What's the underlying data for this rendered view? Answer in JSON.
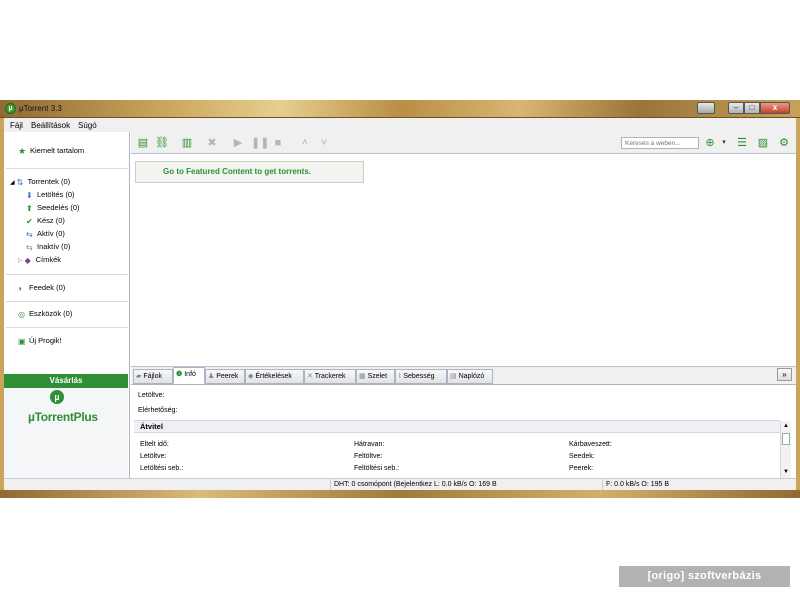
{
  "window": {
    "title": "µTorrent 3.3",
    "icon": "utorrent-logo-icon",
    "controls": {
      "minimize": "–",
      "maximize": "□",
      "close": "x"
    }
  },
  "menu": [
    {
      "label": "Fájl"
    },
    {
      "label": "Beállítások"
    },
    {
      "label": "Súgó"
    }
  ],
  "sidebar": {
    "featured": {
      "label": "Kiemelt tartalom",
      "icon": "star-icon"
    },
    "torrents": {
      "label": "Torrentek (0)",
      "icon": "torrents-icon"
    },
    "categories": [
      {
        "label": "Letöltés (0)",
        "icon": "download-arrow-icon"
      },
      {
        "label": "Seedelés (0)",
        "icon": "upload-arrow-icon"
      },
      {
        "label": "Kész (0)",
        "icon": "checkmark-icon"
      },
      {
        "label": "Aktív (0)",
        "icon": "active-arrows-icon"
      },
      {
        "label": "Inaktív (0)",
        "icon": "inactive-arrows-icon"
      },
      {
        "label": "Címkék",
        "icon": "tag-icon"
      }
    ],
    "feeds": {
      "label": "Feedek (0)",
      "icon": "rss-icon"
    },
    "devices": {
      "label": "Eszközök (0)",
      "icon": "device-icon"
    },
    "apps": {
      "label": "Új Progik!",
      "icon": "apps-icon"
    },
    "buy": {
      "label": "Vásárlás"
    },
    "plus_logo": "µTorrentPlus"
  },
  "toolbar": {
    "buttons": [
      {
        "name": "add-torrent",
        "icon": "add-torrent-icon"
      },
      {
        "name": "add-url",
        "icon": "add-link-icon"
      },
      {
        "name": "create-torrent",
        "icon": "create-torrent-icon"
      },
      {
        "name": "remove",
        "icon": "remove-x-icon"
      },
      {
        "name": "start",
        "icon": "play-icon"
      },
      {
        "name": "pause",
        "icon": "pause-icon"
      },
      {
        "name": "stop",
        "icon": "stop-icon"
      },
      {
        "name": "move-up",
        "icon": "chevron-up-icon"
      },
      {
        "name": "move-down",
        "icon": "chevron-down-icon"
      }
    ],
    "search_placeholder": "Keresés a weben...",
    "right_buttons": [
      {
        "name": "search-engine",
        "icon": "globe-search-icon"
      },
      {
        "name": "list-view",
        "icon": "list-view-icon"
      },
      {
        "name": "remote",
        "icon": "remote-icon"
      },
      {
        "name": "settings",
        "icon": "gear-icon"
      }
    ]
  },
  "featured_banner": "Go to Featured Content to get torrents.",
  "tabs": [
    {
      "label": "Fájlok",
      "icon": "folder-icon"
    },
    {
      "label": "Infó",
      "icon": "info-icon",
      "active": true
    },
    {
      "label": "Peerek",
      "icon": "peers-icon"
    },
    {
      "label": "Értékelések",
      "icon": "ratings-icon"
    },
    {
      "label": "Trackerek",
      "icon": "trackers-icon"
    },
    {
      "label": "Szelet",
      "icon": "pieces-icon"
    },
    {
      "label": "Sebesség",
      "icon": "speed-graph-icon"
    },
    {
      "label": "Naplózó",
      "icon": "logger-icon"
    }
  ],
  "info": {
    "downloaded": "Letöltve:",
    "availability": "Elérhetőség:",
    "transfer_group": "Átvitel",
    "rows": [
      [
        "Eltelt idő:",
        "Hátravan:",
        "Kárbaveszett:"
      ],
      [
        "Letöltve:",
        "Feltöltve:",
        "Seedek:"
      ],
      [
        "Letöltési seb.:",
        "Feltöltési seb.:",
        "Peerek:"
      ]
    ]
  },
  "status": {
    "dht": "DHT: 0 csomópont (Bejelentkez L: 0.0 kB/s O: 169 B",
    "upload": "F: 0.0 kB/s O: 195 B"
  },
  "watermark": "[origo] szoftverbázis",
  "colors": {
    "accent_green": "#2f8f34",
    "title_gold": "#c9a45a"
  }
}
